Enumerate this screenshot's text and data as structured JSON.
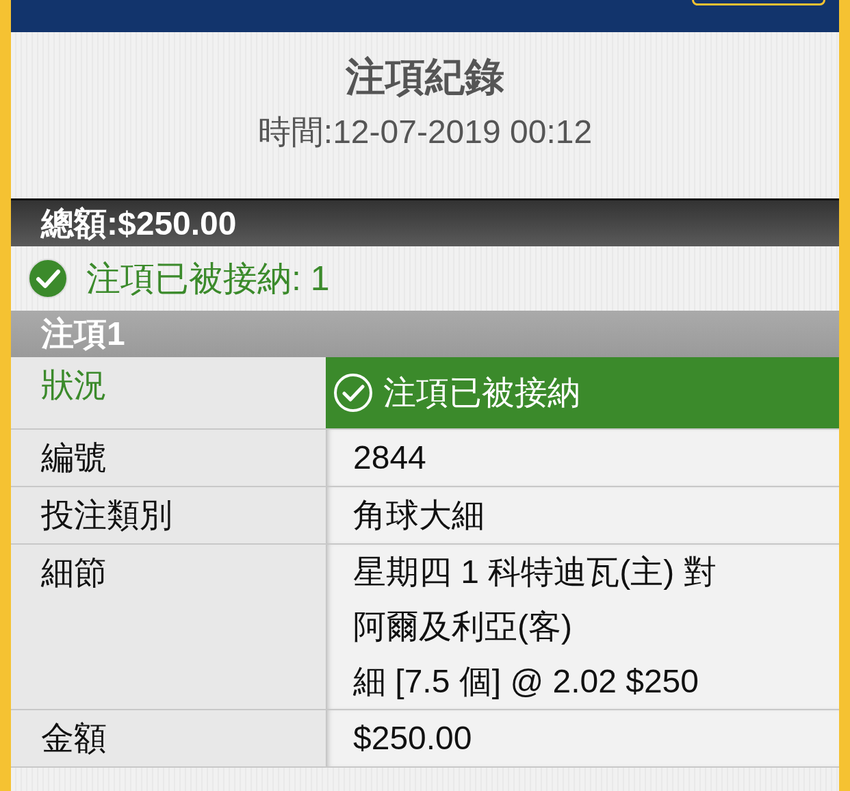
{
  "header": {
    "title": "注項紀錄",
    "time": "時間:12-07-2019 00:12"
  },
  "total": "總額:$250.00",
  "summary": {
    "accepted": true,
    "text": "注項已被接納: 1"
  },
  "bets": [
    {
      "title": "注項1",
      "rows": [
        {
          "kind": "status",
          "label": "狀況",
          "accepted": true,
          "lines": [
            "注項已被接納"
          ]
        },
        {
          "kind": "text",
          "label": "編號",
          "lines": [
            "2844"
          ]
        },
        {
          "kind": "text",
          "label": "投注類別",
          "lines": [
            "角球大細"
          ]
        },
        {
          "kind": "text",
          "label": "細節",
          "lines": [
            "星期四 1 科特迪瓦(主) 對",
            "阿爾及利亞(客)",
            "細 [7.5 個] @ 2.02 $250"
          ]
        },
        {
          "kind": "text",
          "label": "金額",
          "lines": [
            "$250.00"
          ]
        }
      ]
    }
  ]
}
